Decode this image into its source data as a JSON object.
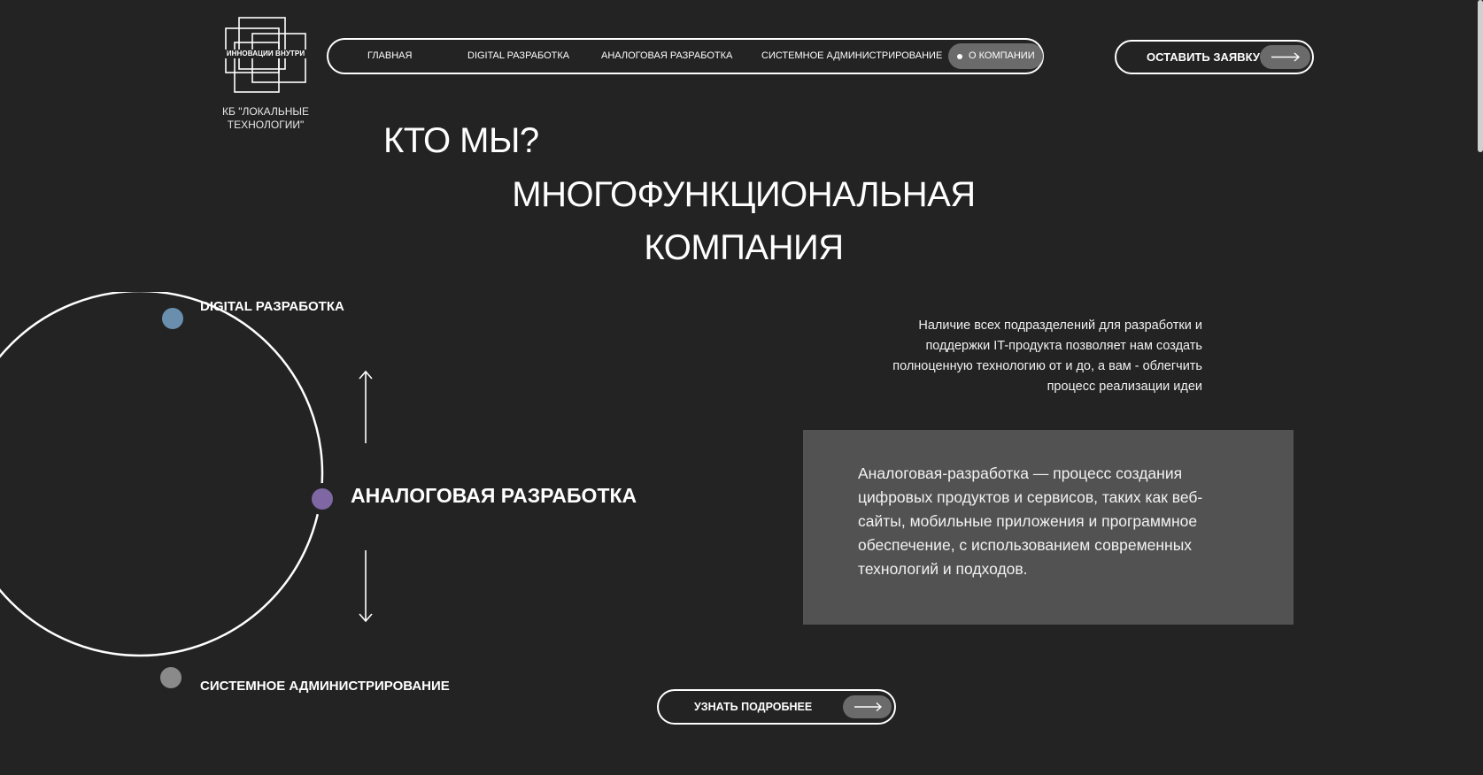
{
  "logo": {
    "text": "ИННОВАЦИИ ВНУТРИ",
    "company_name": "КБ \"ЛОКАЛЬНЫЕ ТЕХНОЛОГИИ\""
  },
  "nav": {
    "items": [
      {
        "label": "ГЛАВНАЯ"
      },
      {
        "label": "DIGITAL РАЗРАБОТКА"
      },
      {
        "label": "АНАЛОГОВАЯ РАЗРАБОТКА"
      },
      {
        "label": "СИСТЕМНОЕ АДМИНИСТРИРОВАНИЕ"
      },
      {
        "label": "О КОМПАНИИ",
        "active": true
      }
    ]
  },
  "cta": {
    "label": "ОСТАВИТЬ ЗАЯВКУ",
    "icon": "arrow-right-icon"
  },
  "hero": {
    "who": "КТО МЫ?",
    "line1": "МНОГОФУНКЦИОНАЛЬНАЯ",
    "line2": "КОМПАНИЯ"
  },
  "diagram": {
    "top_label": "DIGITAL РАЗРАБОТКА",
    "mid_label": "АНАЛОГОВАЯ РАЗРАБОТКА",
    "bottom_label": "СИСТЕМНОЕ АДМИНИСТРИРОВАНИЕ",
    "colors": {
      "top": "#6a8fae",
      "mid": "#7e67a3",
      "bottom": "#8a8a8a"
    }
  },
  "description": "Наличие всех подразделений для разработки и поддержки IT-продукта позволяет нам создать полноценную технологию от и до, а вам - облегчить процесс реализации идеи",
  "card": {
    "text": "Аналоговая-разработка — процесс создания цифровых продуктов и сервисов, таких как веб-сайты, мобильные приложения и программное обеспечение, с использованием современных технологий и подходов."
  },
  "more_button": {
    "label": "УЗНАТЬ ПОДРОБНЕЕ",
    "icon": "arrow-right-icon"
  },
  "theme": {
    "background": "#232323",
    "card": "#525252",
    "pill": "#6b6b6b"
  }
}
